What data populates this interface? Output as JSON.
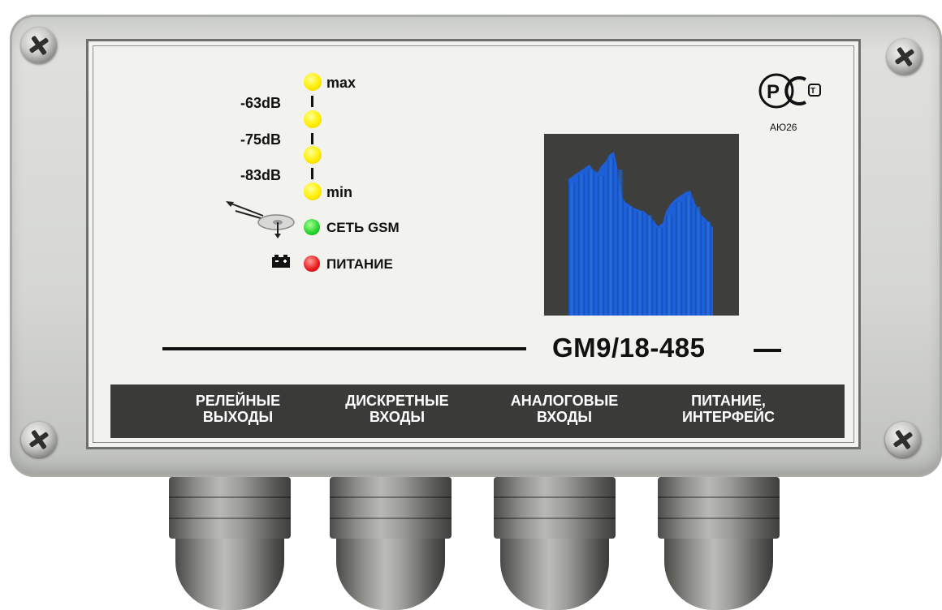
{
  "signal": {
    "db_labels": [
      "-63dB",
      "-75dB",
      "-83dB"
    ],
    "max_label": "max",
    "min_label": "min"
  },
  "status": {
    "gsm_label": "СЕТЬ GSM",
    "power_label": "ПИТАНИЕ"
  },
  "certification": {
    "mark_text": "АЮ26"
  },
  "model": {
    "name": "GM9/18-485"
  },
  "connectors": [
    {
      "line1": "РЕЛЕЙНЫЕ",
      "line2": "ВЫХОДЫ"
    },
    {
      "line1": "ДИСКРЕТНЫЕ",
      "line2": "ВХОДЫ"
    },
    {
      "line1": "АНАЛОГОВЫЕ",
      "line2": "ВХОДЫ"
    },
    {
      "line1": "ПИТАНИЕ,",
      "line2": "ИНТЕРФЕЙС"
    }
  ],
  "colors": {
    "led_yellow": "#ffee00",
    "led_green": "#24d22a",
    "led_red": "#e81717",
    "graph_bg": "#3e3e3c",
    "graph_bar": "#1d5fd6",
    "strip_bg": "#3a3a38"
  },
  "icons": [
    "antenna-icon",
    "battery-icon",
    "screw-icon",
    "pct-cert-icon"
  ]
}
